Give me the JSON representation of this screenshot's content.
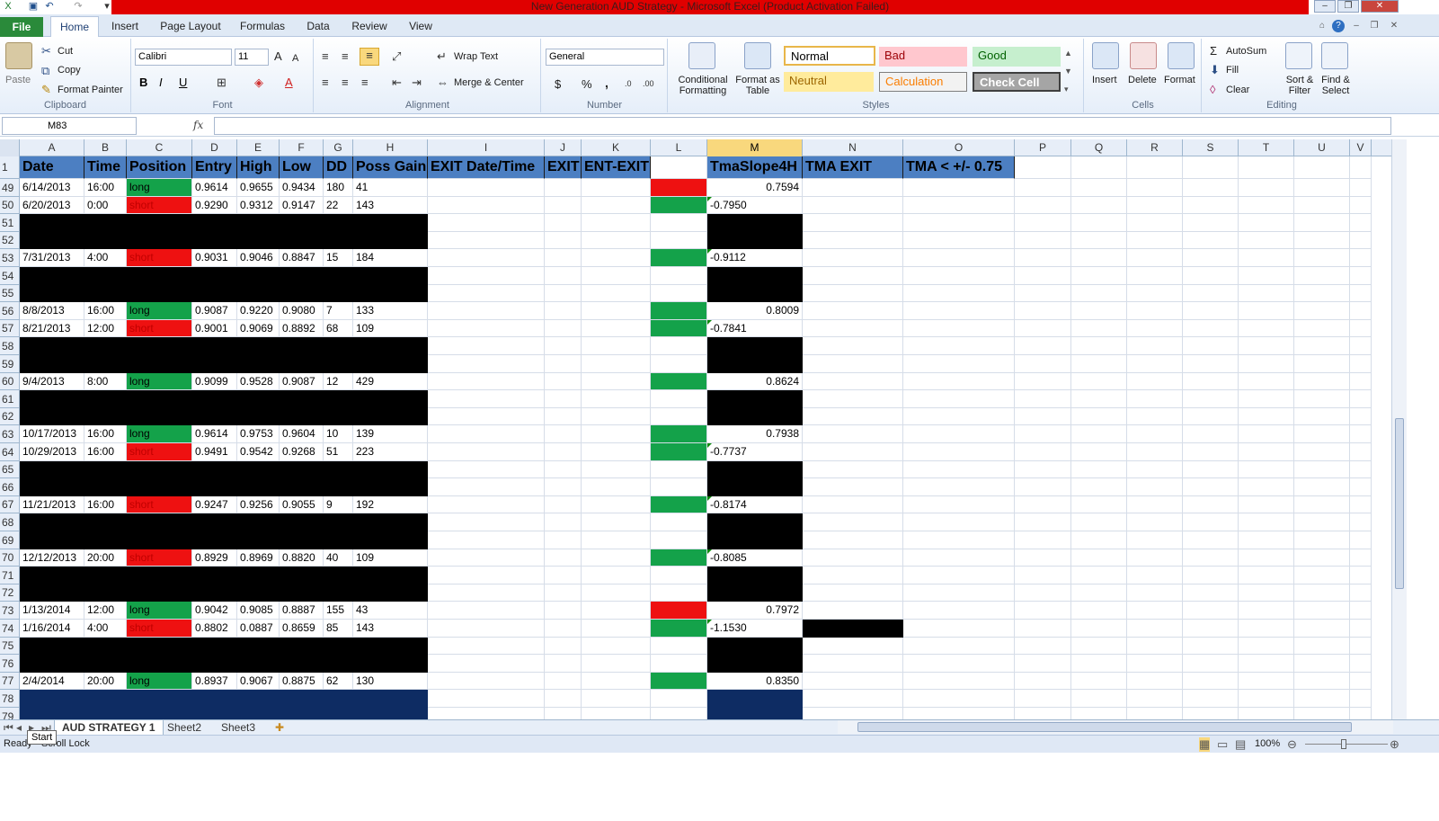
{
  "window": {
    "title": "New Generation AUD Strategy  -  Microsoft Excel (Product Activation Failed)"
  },
  "tabs": [
    "File",
    "Home",
    "Insert",
    "Page Layout",
    "Formulas",
    "Data",
    "Review",
    "View"
  ],
  "clipboard": {
    "paste": "Paste",
    "cut": "Cut",
    "copy": "Copy",
    "format_painter": "Format Painter",
    "label": "Clipboard"
  },
  "font": {
    "name": "Calibri",
    "size": "11",
    "label": "Font"
  },
  "alignment": {
    "wrap": "Wrap Text",
    "merge": "Merge & Center",
    "label": "Alignment"
  },
  "number": {
    "format": "General",
    "dollar": "$",
    "percent": "%",
    "comma": ",",
    "label": "Number"
  },
  "styles": {
    "conditional": "Conditional Formatting",
    "format_table": "Format as Table",
    "normal": "Normal",
    "bad": "Bad",
    "good": "Good",
    "neutral": "Neutral",
    "calculation": "Calculation",
    "check_cell": "Check Cell",
    "label": "Styles"
  },
  "cells": {
    "insert": "Insert",
    "delete": "Delete",
    "format": "Format",
    "label": "Cells"
  },
  "editing": {
    "autosum": "AutoSum",
    "fill": "Fill",
    "clear": "Clear",
    "sort": "Sort & Filter",
    "find": "Find & Select",
    "label": "Editing"
  },
  "formula_bar": {
    "name_box": "M83",
    "fx": "fx",
    "content": ""
  },
  "columns": [
    "A",
    "B",
    "C",
    "D",
    "E",
    "F",
    "G",
    "H",
    "I",
    "J",
    "K",
    "L",
    "M",
    "N",
    "O",
    "P",
    "Q",
    "R",
    "S",
    "T",
    "U",
    "V"
  ],
  "header_row": {
    "num": "1",
    "cells": [
      "Date",
      "Time",
      "Position",
      "Entry",
      "High",
      "Low",
      "DD",
      "Poss Gain",
      "EXIT Date/Time",
      "EXIT",
      "ENT-EXIT",
      "",
      "TmaSlope4H",
      "TMA EXIT",
      "TMA < +/- 0.75"
    ]
  },
  "rows": [
    {
      "num": "49",
      "type": "data",
      "date": "6/14/2013",
      "time": "16:00",
      "pos": "long",
      "entry": "0.9614",
      "high": "0.9655",
      "low": "0.9434",
      "dd": "180",
      "gain": "41",
      "l": "red",
      "m": "0.7594",
      "neg": false
    },
    {
      "num": "50",
      "type": "data",
      "date": "6/20/2013",
      "time": "0:00",
      "pos": "short",
      "entry": "0.9290",
      "high": "0.9312",
      "low": "0.9147",
      "dd": "22",
      "gain": "143",
      "l": "green",
      "m": "-0.7950",
      "neg": true
    },
    {
      "num": "51",
      "type": "black"
    },
    {
      "num": "52",
      "type": "black"
    },
    {
      "num": "53",
      "type": "data",
      "date": "7/31/2013",
      "time": "4:00",
      "pos": "short",
      "entry": "0.9031",
      "high": "0.9046",
      "low": "0.8847",
      "dd": "15",
      "gain": "184",
      "l": "green",
      "m": "-0.9112",
      "neg": true
    },
    {
      "num": "54",
      "type": "black"
    },
    {
      "num": "55",
      "type": "black"
    },
    {
      "num": "56",
      "type": "data",
      "date": "8/8/2013",
      "time": "16:00",
      "pos": "long",
      "entry": "0.9087",
      "high": "0.9220",
      "low": "0.9080",
      "dd": "7",
      "gain": "133",
      "l": "green",
      "m": "0.8009",
      "neg": false
    },
    {
      "num": "57",
      "type": "data",
      "date": "8/21/2013",
      "time": "12:00",
      "pos": "short",
      "entry": "0.9001",
      "high": "0.9069",
      "low": "0.8892",
      "dd": "68",
      "gain": "109",
      "l": "green",
      "m": "-0.7841",
      "neg": true
    },
    {
      "num": "58",
      "type": "black"
    },
    {
      "num": "59",
      "type": "black"
    },
    {
      "num": "60",
      "type": "data",
      "date": "9/4/2013",
      "time": "8:00",
      "pos": "long",
      "entry": "0.9099",
      "high": "0.9528",
      "low": "0.9087",
      "dd": "12",
      "gain": "429",
      "l": "green",
      "m": "0.8624",
      "neg": false
    },
    {
      "num": "61",
      "type": "black"
    },
    {
      "num": "62",
      "type": "black"
    },
    {
      "num": "63",
      "type": "data",
      "date": "10/17/2013",
      "time": "16:00",
      "pos": "long",
      "entry": "0.9614",
      "high": "0.9753",
      "low": "0.9604",
      "dd": "10",
      "gain": "139",
      "l": "green",
      "m": "0.7938",
      "neg": false
    },
    {
      "num": "64",
      "type": "data",
      "date": "10/29/2013",
      "time": "16:00",
      "pos": "short",
      "entry": "0.9491",
      "high": "0.9542",
      "low": "0.9268",
      "dd": "51",
      "gain": "223",
      "l": "green",
      "m": "-0.7737",
      "neg": true
    },
    {
      "num": "65",
      "type": "black"
    },
    {
      "num": "66",
      "type": "black"
    },
    {
      "num": "67",
      "type": "data",
      "date": "11/21/2013",
      "time": "16:00",
      "pos": "short",
      "entry": "0.9247",
      "high": "0.9256",
      "low": "0.9055",
      "dd": "9",
      "gain": "192",
      "l": "green",
      "m": "-0.8174",
      "neg": true
    },
    {
      "num": "68",
      "type": "black"
    },
    {
      "num": "69",
      "type": "black"
    },
    {
      "num": "70",
      "type": "data",
      "date": "12/12/2013",
      "time": "20:00",
      "pos": "short",
      "entry": "0.8929",
      "high": "0.8969",
      "low": "0.8820",
      "dd": "40",
      "gain": "109",
      "l": "green",
      "m": "-0.8085",
      "neg": true
    },
    {
      "num": "71",
      "type": "black"
    },
    {
      "num": "72",
      "type": "black"
    },
    {
      "num": "73",
      "type": "data",
      "date": "1/13/2014",
      "time": "12:00",
      "pos": "long",
      "entry": "0.9042",
      "high": "0.9085",
      "low": "0.8887",
      "dd": "155",
      "gain": "43",
      "l": "red",
      "m": "0.7972",
      "neg": false
    },
    {
      "num": "74",
      "type": "data",
      "date": "1/16/2014",
      "time": "4:00",
      "pos": "short",
      "entry": "0.8802",
      "high": "0.0887",
      "low": "0.8659",
      "dd": "85",
      "gain": "143",
      "l": "green",
      "m": "-1.1530",
      "neg": true,
      "n_black": true
    },
    {
      "num": "75",
      "type": "black"
    },
    {
      "num": "76",
      "type": "black"
    },
    {
      "num": "77",
      "type": "data",
      "date": "2/4/2014",
      "time": "20:00",
      "pos": "long",
      "entry": "0.8937",
      "high": "0.9067",
      "low": "0.8875",
      "dd": "62",
      "gain": "130",
      "l": "green",
      "m": "0.8350",
      "neg": false
    },
    {
      "num": "78",
      "type": "navy"
    },
    {
      "num": "79",
      "type": "navy"
    }
  ],
  "sheets": [
    "AUD STRATEGY 1",
    "Sheet2",
    "Sheet3"
  ],
  "status": {
    "ready": "Ready",
    "scroll_lock": "Scroll Lock",
    "tooltip": "Start",
    "zoom": "100%"
  },
  "colors": {
    "header_blue": "#4c7fc2",
    "green": "#14a24a",
    "red": "#ee1111",
    "navy": "#0e2c63"
  }
}
